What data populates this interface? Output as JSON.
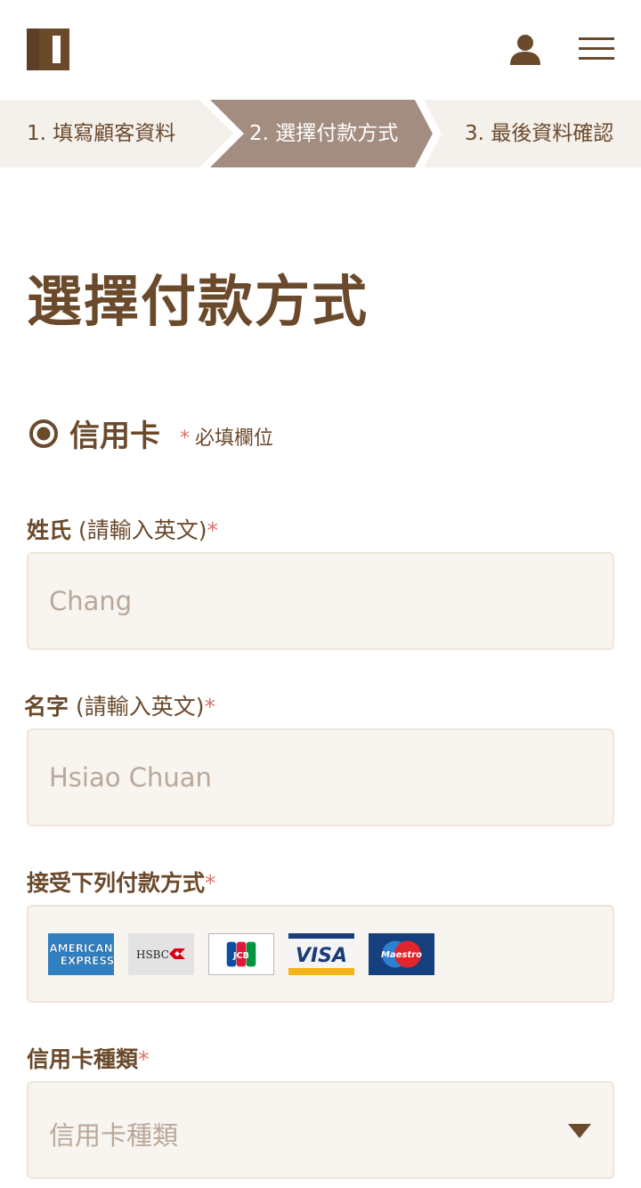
{
  "steps": [
    {
      "label": "1. 填寫顧客資料",
      "state": "done"
    },
    {
      "label": "2. 選擇付款方式",
      "state": "active"
    },
    {
      "label": "3. 最後資料確認",
      "state": "pending"
    }
  ],
  "title": "選擇付款方式",
  "payment_method": {
    "label": "信用卡",
    "selected": true
  },
  "required_note": {
    "star": "*",
    "text": "必填欄位"
  },
  "fields": {
    "last_name": {
      "label_bold": "姓氏",
      "label_rest": " (請輸入英文)",
      "star": "*",
      "value": "Chang"
    },
    "first_name": {
      "label_bold": "名字",
      "label_rest": " (請輸入英文)",
      "star": "*",
      "value": "Hsiao Chuan"
    },
    "accepted_cards": {
      "label_bold": "接受下列付款方式",
      "star": "*"
    },
    "card_type": {
      "label_bold": "信用卡種類",
      "star": "*",
      "placeholder": "信用卡種類"
    }
  },
  "cards": [
    {
      "name": "American Express",
      "icon": "amex-logo-icon"
    },
    {
      "name": "HSBC",
      "icon": "hsbc-logo-icon"
    },
    {
      "name": "JCB",
      "icon": "jcb-logo-icon"
    },
    {
      "name": "VISA",
      "icon": "visa-logo-icon"
    },
    {
      "name": "Maestro",
      "icon": "maestro-logo-icon"
    }
  ],
  "card_texts": {
    "amex_line1": "AMERICAN",
    "amex_line2": "EXPRESS",
    "hsbc": "HSBC",
    "jcb": "JCB",
    "visa": "VISA",
    "maestro": "Maestro"
  },
  "colors": {
    "brand_brown": "#6b4a2c",
    "active_step": "#a38d80",
    "steps_bg": "#f4f0eb",
    "field_bg": "#f8f4f0",
    "required_star": "#d9736b",
    "placeholder_text": "#b9a89a"
  },
  "icons": {
    "logo": "logo-icon",
    "user": "user-icon",
    "menu": "hamburger-menu-icon",
    "radio": "radio-selected-icon",
    "dropdown": "caret-down-icon"
  }
}
